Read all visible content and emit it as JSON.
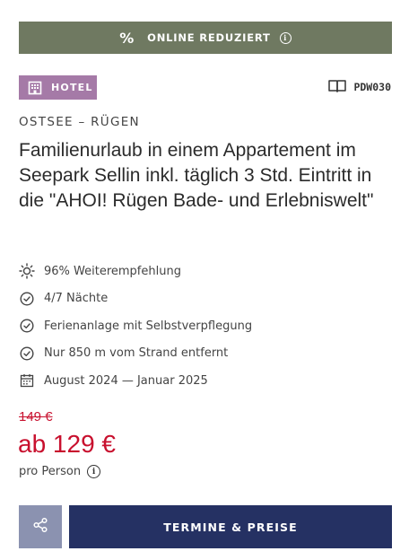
{
  "banner": {
    "label": "ONLINE REDUZIERT",
    "icon": "percent-icon",
    "info_icon": "info-icon"
  },
  "badge": {
    "label": "HOTEL",
    "icon": "hotel-icon"
  },
  "offer_code": {
    "label": "PDW030",
    "icon": "book-icon"
  },
  "region": "OSTSEE – RÜGEN",
  "title": "Familienurlaub in einem Appartement im Seepark Sellin inkl. täglich 3 Std. Eintritt in die \"AHOI! Rügen Bade- und Erlebniswelt\"",
  "features": [
    {
      "icon": "sun-icon",
      "text": "96% Weiterempfehlung"
    },
    {
      "icon": "check-circle-icon",
      "text": "4/7 Nächte"
    },
    {
      "icon": "check-circle-icon",
      "text": "Ferienanlage mit Selbstverpflegung"
    },
    {
      "icon": "check-circle-icon",
      "text": "Nur 850 m vom Strand entfernt"
    },
    {
      "icon": "calendar-icon",
      "text": "August 2024 — Januar 2025"
    }
  ],
  "price": {
    "old": "149 €",
    "current": "ab 129 €",
    "per_person": "pro Person"
  },
  "buttons": {
    "share_icon": "share-icon",
    "cta": "TERMINE & PREISE"
  },
  "colors": {
    "banner": "#6f7961",
    "badge": "#a57aa7",
    "price": "#c8102e",
    "cta": "#253163",
    "share": "#8b92b0"
  }
}
